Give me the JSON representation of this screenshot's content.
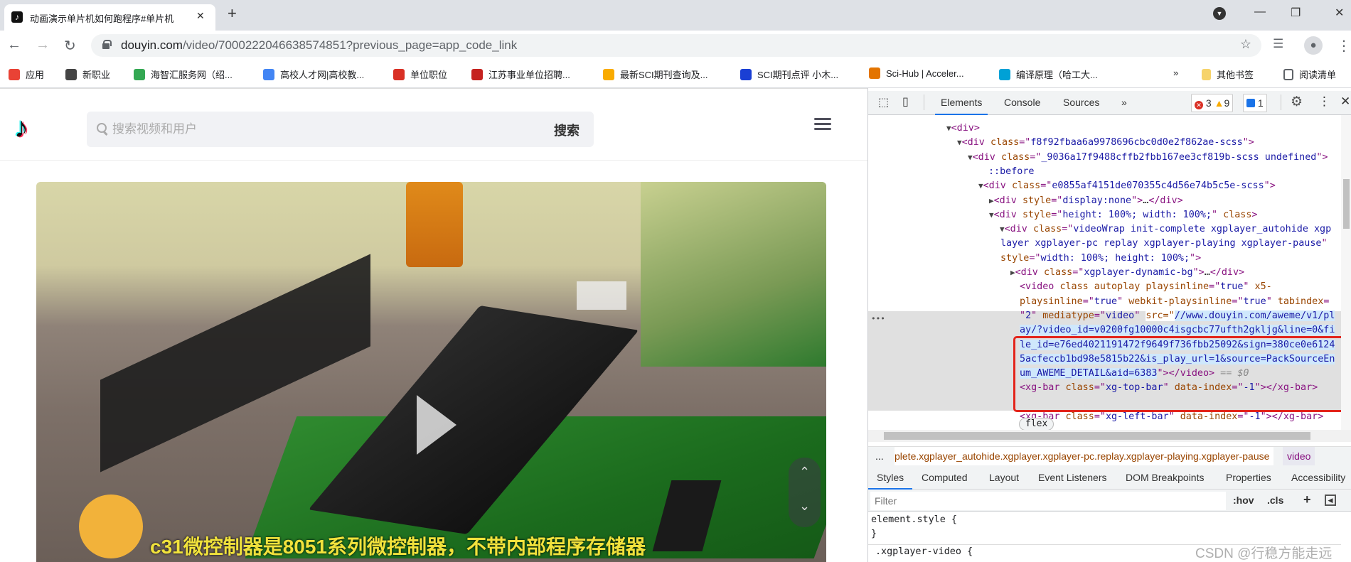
{
  "browser": {
    "tab_title": "动画演示单片机如何跑程序#单片机",
    "new_tab": "+",
    "url_host": "douyin.com",
    "url_path": "/video/7000222046638574851?previous_page=app_code_link",
    "bookmarks": [
      {
        "label": "应用",
        "color": "#e94235"
      },
      {
        "label": "新职业",
        "color": "#444444"
      },
      {
        "label": "海智汇服务网（绍...",
        "color": "#34a853"
      },
      {
        "label": "高校人才网|高校教...",
        "color": "#4285f4"
      },
      {
        "label": "单位职位",
        "color": "#d93025"
      },
      {
        "label": "江苏事业单位招聘...",
        "color": "#c5221f"
      },
      {
        "label": "最新SCI期刊查询及...",
        "color": "#f9ab00"
      },
      {
        "label": "SCI期刊点评 小木...",
        "color": "#1a3fd4"
      },
      {
        "label": "Sci-Hub | Acceler...",
        "color": "#e37400"
      },
      {
        "label": "编译原理（哈工大...",
        "color": "#00a1d6"
      }
    ],
    "bookmarks_more": "»",
    "other_bookmarks": "其他书签",
    "reading_list": "阅读清单"
  },
  "douyin": {
    "search_placeholder": "搜索视频和用户",
    "search_button": "搜索",
    "subtitle": "c31微控制器是8051系列微控制器，不带内部程序存储器"
  },
  "devtools": {
    "tabs": [
      "Elements",
      "Console",
      "Sources"
    ],
    "more_tabs": "»",
    "errors": "3",
    "warnings": "9",
    "issues": "1",
    "dom_lines": [
      {
        "arrow": "▼",
        "segs": [
          [
            "t",
            "<div>"
          ]
        ]
      },
      {
        "arrow": "▼",
        "segs": [
          [
            "t",
            "<div "
          ],
          [
            "a",
            "class"
          ],
          [
            "p",
            "=\""
          ],
          [
            "v",
            "f8f92fbaa6a9978696cbc0d0e2f862ae-scss"
          ],
          [
            "p",
            "\">"
          ]
        ]
      },
      {
        "arrow": "▼",
        "segs": [
          [
            "t",
            "<div "
          ],
          [
            "a",
            "class"
          ],
          [
            "p",
            "=\""
          ],
          [
            "v",
            "_9036a17f9488cffb2fbb167ee3cf819b-scss undefined"
          ],
          [
            "p",
            "\">"
          ]
        ]
      },
      {
        "arrow": "",
        "segs": [
          [
            "ps",
            "::before"
          ]
        ]
      },
      {
        "arrow": "▼",
        "segs": [
          [
            "t",
            "<div "
          ],
          [
            "a",
            "class"
          ],
          [
            "p",
            "=\""
          ],
          [
            "v",
            "e0855af4151de070355c4d56e74b5c5e-scss"
          ],
          [
            "p",
            "\">"
          ]
        ]
      },
      {
        "arrow": "▶",
        "segs": [
          [
            "t",
            "<div "
          ],
          [
            "a",
            "style"
          ],
          [
            "p",
            "=\""
          ],
          [
            "v",
            "display:none"
          ],
          [
            "p",
            "\">"
          ],
          [
            "tx",
            "…"
          ],
          [
            "t",
            "</div>"
          ]
        ]
      },
      {
        "arrow": "▼",
        "segs": [
          [
            "t",
            "<div "
          ],
          [
            "a",
            "style"
          ],
          [
            "p",
            "=\""
          ],
          [
            "v",
            "height: 100%; width: 100%;"
          ],
          [
            "p",
            "\" "
          ],
          [
            "a",
            "class"
          ],
          [
            "t",
            ">"
          ]
        ]
      },
      {
        "arrow": "▼",
        "segs": [
          [
            "t",
            "<div "
          ],
          [
            "a",
            "class"
          ],
          [
            "p",
            "=\""
          ],
          [
            "v",
            "videoWrap init-complete xgplayer_autohide xgp"
          ]
        ]
      },
      {
        "arrow": "",
        "segs": [
          [
            "v",
            "layer xgplayer-pc replay xgplayer-playing xgplayer-pause"
          ],
          [
            "p",
            "\""
          ]
        ]
      },
      {
        "arrow": "",
        "segs": [
          [
            "a",
            "style"
          ],
          [
            "p",
            "=\""
          ],
          [
            "v",
            "width: 100%; height: 100%;"
          ],
          [
            "p",
            "\">"
          ]
        ]
      },
      {
        "arrow": "▶",
        "segs": [
          [
            "t",
            "<div "
          ],
          [
            "a",
            "class"
          ],
          [
            "p",
            "=\""
          ],
          [
            "v",
            "xgplayer-dynamic-bg"
          ],
          [
            "p",
            "\">"
          ],
          [
            "tx",
            "…"
          ],
          [
            "t",
            "</div>"
          ]
        ]
      },
      {
        "arrow": "",
        "segs": [
          [
            "t",
            "<video "
          ],
          [
            "a",
            "class autoplay playsinline"
          ],
          [
            "p",
            "=\""
          ],
          [
            "v",
            "true"
          ],
          [
            "p",
            "\" "
          ],
          [
            "a",
            "x5-"
          ]
        ]
      },
      {
        "arrow": "",
        "segs": [
          [
            "a",
            "playsinline"
          ],
          [
            "p",
            "=\""
          ],
          [
            "v",
            "true"
          ],
          [
            "p",
            "\" "
          ],
          [
            "a",
            "webkit-playsinline"
          ],
          [
            "p",
            "=\""
          ],
          [
            "v",
            "true"
          ],
          [
            "p",
            "\" "
          ],
          [
            "a",
            "tabindex"
          ],
          [
            "p",
            "="
          ]
        ]
      },
      {
        "arrow": "",
        "segs": [
          [
            "p",
            "\""
          ],
          [
            "v",
            "2"
          ],
          [
            "p",
            "\" "
          ],
          [
            "a",
            "mediatype"
          ],
          [
            "p",
            "=\""
          ],
          [
            "v",
            "video"
          ],
          [
            "p",
            "\" "
          ],
          [
            "hs",
            "src=\""
          ],
          [
            "hv",
            "//www.douyin.com/aweme/v1/pl"
          ]
        ]
      },
      {
        "arrow": "",
        "segs": [
          [
            "hv",
            "ay/?video_id=v0200fg10000c4isgcbc77ufth2gkljg&line=0&fi"
          ]
        ]
      },
      {
        "arrow": "",
        "segs": [
          [
            "hv",
            "le_id=e76ed4021191472f9649f736fbb25092&sign=380ce0e6124"
          ]
        ]
      },
      {
        "arrow": "",
        "segs": [
          [
            "hv",
            "5acfeccb1bd98e5815b22&is_play_url=1&source=PackSourceEn"
          ]
        ]
      },
      {
        "arrow": "",
        "segs": [
          [
            "hv",
            "um_AWEME_DETAIL&aid=6383"
          ],
          [
            "p",
            "\">"
          ],
          [
            "t",
            "</video>"
          ],
          [
            "g",
            " == $0"
          ]
        ]
      },
      {
        "arrow": "",
        "segs": [
          [
            "t",
            "<xg-bar "
          ],
          [
            "a",
            "class"
          ],
          [
            "p",
            "=\""
          ],
          [
            "v",
            "xg-top-bar"
          ],
          [
            "p",
            "\" "
          ],
          [
            "a",
            "data-index"
          ],
          [
            "p",
            "=\""
          ],
          [
            "v",
            "-1"
          ],
          [
            "p",
            "\">"
          ],
          [
            "t",
            "</xg-bar>"
          ]
        ]
      },
      {
        "arrow": "",
        "segs": []
      },
      {
        "arrow": "",
        "segs": [
          [
            "t",
            "<xg-bar "
          ],
          [
            "a",
            "class"
          ],
          [
            "p",
            "=\""
          ],
          [
            "v",
            "xg-left-bar"
          ],
          [
            "p",
            "\" "
          ],
          [
            "a",
            "data-index"
          ],
          [
            "p",
            "=\""
          ],
          [
            "v",
            "-1"
          ],
          [
            "p",
            "\">"
          ],
          [
            "t",
            "</xg-bar>"
          ]
        ]
      }
    ],
    "flex_badge": "flex",
    "selected_marker": "•••",
    "breadcrumb_dots": "...",
    "breadcrumb_path": "plete.xgplayer_autohide.xgplayer.xgplayer-pc.replay.xgplayer-playing.xgplayer-pause",
    "breadcrumb_current": "video",
    "style_tabs": [
      "Styles",
      "Computed",
      "Layout",
      "Event Listeners",
      "DOM Breakpoints",
      "Properties",
      "Accessibility"
    ],
    "filter_placeholder": "Filter",
    "hov": ":hov",
    "cls": ".cls",
    "plus": "+",
    "rule1_open": "element.style {",
    "rule1_close": "}",
    "rule2_open": ".xgplayer-video {"
  },
  "watermark": "CSDN @行稳方能走远"
}
